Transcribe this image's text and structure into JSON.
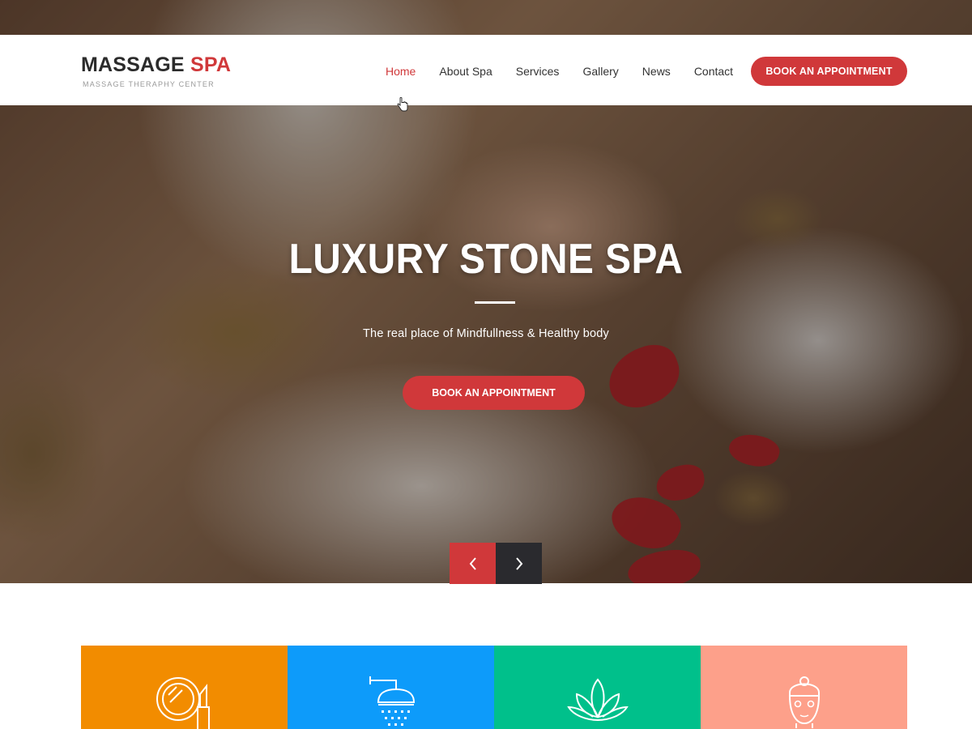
{
  "brand": {
    "name_primary": "MASSAGE",
    "name_accent": "SPA",
    "tagline": "MASSAGE THERAPHY CENTER"
  },
  "nav": {
    "items": [
      {
        "label": "Home",
        "active": true
      },
      {
        "label": "About Spa",
        "active": false
      },
      {
        "label": "Services",
        "active": false
      },
      {
        "label": "Gallery",
        "active": false
      },
      {
        "label": "News",
        "active": false
      },
      {
        "label": "Contact",
        "active": false
      }
    ],
    "cta_label": "BOOK AN APPOINTMENT"
  },
  "hero": {
    "title": "LUXURY STONE SPA",
    "subtitle": "The real place of Mindfullness & Healthy body",
    "cta_label": "BOOK AN APPOINTMENT",
    "prev_icon": "chevron-left-icon",
    "next_icon": "chevron-right-icon"
  },
  "tiles": [
    {
      "icon": "mirror-lipstick-icon",
      "color": "#f28c00"
    },
    {
      "icon": "shower-icon",
      "color": "#0d9bfa"
    },
    {
      "icon": "lotus-icon",
      "color": "#00c08b"
    },
    {
      "icon": "face-towel-icon",
      "color": "#fda08a"
    }
  ],
  "colors": {
    "accent": "#d0383a",
    "dark": "#2a2a2e"
  }
}
